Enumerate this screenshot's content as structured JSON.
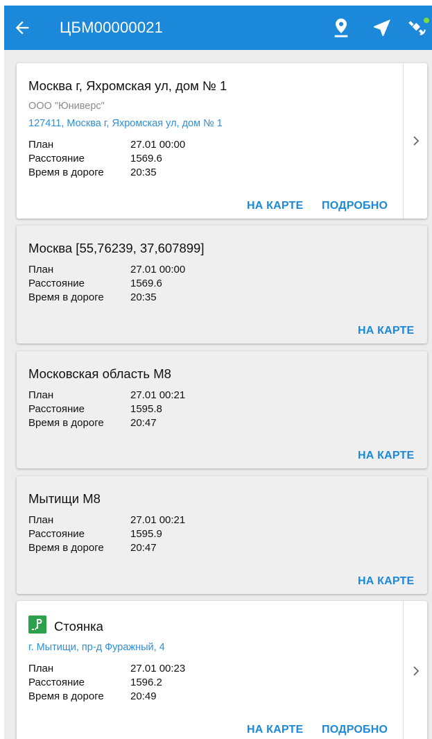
{
  "header": {
    "title": "ЦБМ00000021",
    "accent": "#1b88d9",
    "icons": [
      "back-arrow-icon",
      "map-pin-icon",
      "navigation-arrow-icon",
      "gps-satellite-icon"
    ]
  },
  "labels": {
    "plan": "План",
    "distance": "Расстояние",
    "travel_time": "Время в дороге",
    "on_map": "НА КАРТЕ",
    "details": "ПОДРОБНО"
  },
  "points": [
    {
      "name": "Москва г, Яхромская ул, дом № 1",
      "org": "ООО \"Юниверс\"",
      "address": "127411, Москва г, Яхромская ул, дом № 1",
      "plan": "27.01 00:00",
      "distance": "1569.6",
      "time": "20:35"
    },
    {
      "name": "Москва [55,76239, 37,607899]",
      "plan": "27.01 00:00",
      "distance": "1569.6",
      "time": "20:35"
    },
    {
      "name": "Московская область М8",
      "plan": "27.01 00:21",
      "distance": "1595.8",
      "time": "20:47"
    },
    {
      "name": "Мытищи М8",
      "plan": "27.01 00:21",
      "distance": "1595.9",
      "time": "20:47"
    },
    {
      "name": "Стоянка",
      "icon": "parking-icon",
      "address": "г. Мытищи, пр-д Фуражный, 4",
      "plan": "27.01 00:23",
      "distance": "1596.2",
      "time": "20:49"
    }
  ]
}
